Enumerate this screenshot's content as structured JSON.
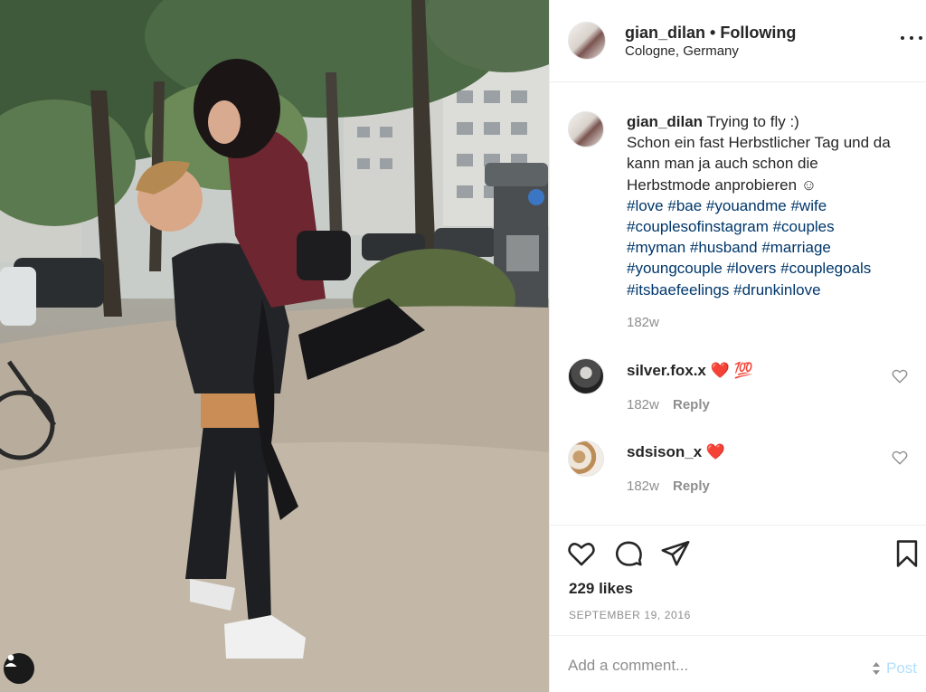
{
  "header": {
    "username": "gian_dilan",
    "separator": "•",
    "follow_status": "Following",
    "location": "Cologne, Germany"
  },
  "caption": {
    "username": "gian_dilan",
    "lines": [
      "Trying to fly :)",
      "Schon ein fast Herbstlicher Tag und da",
      "kann man ja auch schon die",
      "Herbstmode anprobieren ☺"
    ],
    "hashtag_lines": [
      "#love #bae #youandme #wife",
      "#couplesofinstagram #couples",
      "#myman #husband #marriage",
      "#youngcouple #lovers #couplegoals",
      "#itsbaefeelings #drunkinlove"
    ],
    "time": "182w"
  },
  "comments": [
    {
      "username": "silver.fox.x",
      "emoji": "❤️ 💯",
      "time": "182w",
      "reply_label": "Reply"
    },
    {
      "username": "sdsison_x",
      "emoji": "❤️",
      "time": "182w",
      "reply_label": "Reply"
    }
  ],
  "actions": {
    "likes": "229 likes",
    "date": "SEPTEMBER 19, 2016"
  },
  "add_comment": {
    "placeholder": "Add a comment...",
    "post_label": "Post"
  },
  "colors": {
    "hashtag": "#00376b",
    "muted": "#8e8e8e",
    "post_disabled": "#b2dffc",
    "heart_red": "#ed4956"
  },
  "icons": [
    "heart-icon",
    "comment-icon",
    "share-icon",
    "bookmark-icon",
    "more-options-icon",
    "user-tag-icon"
  ]
}
